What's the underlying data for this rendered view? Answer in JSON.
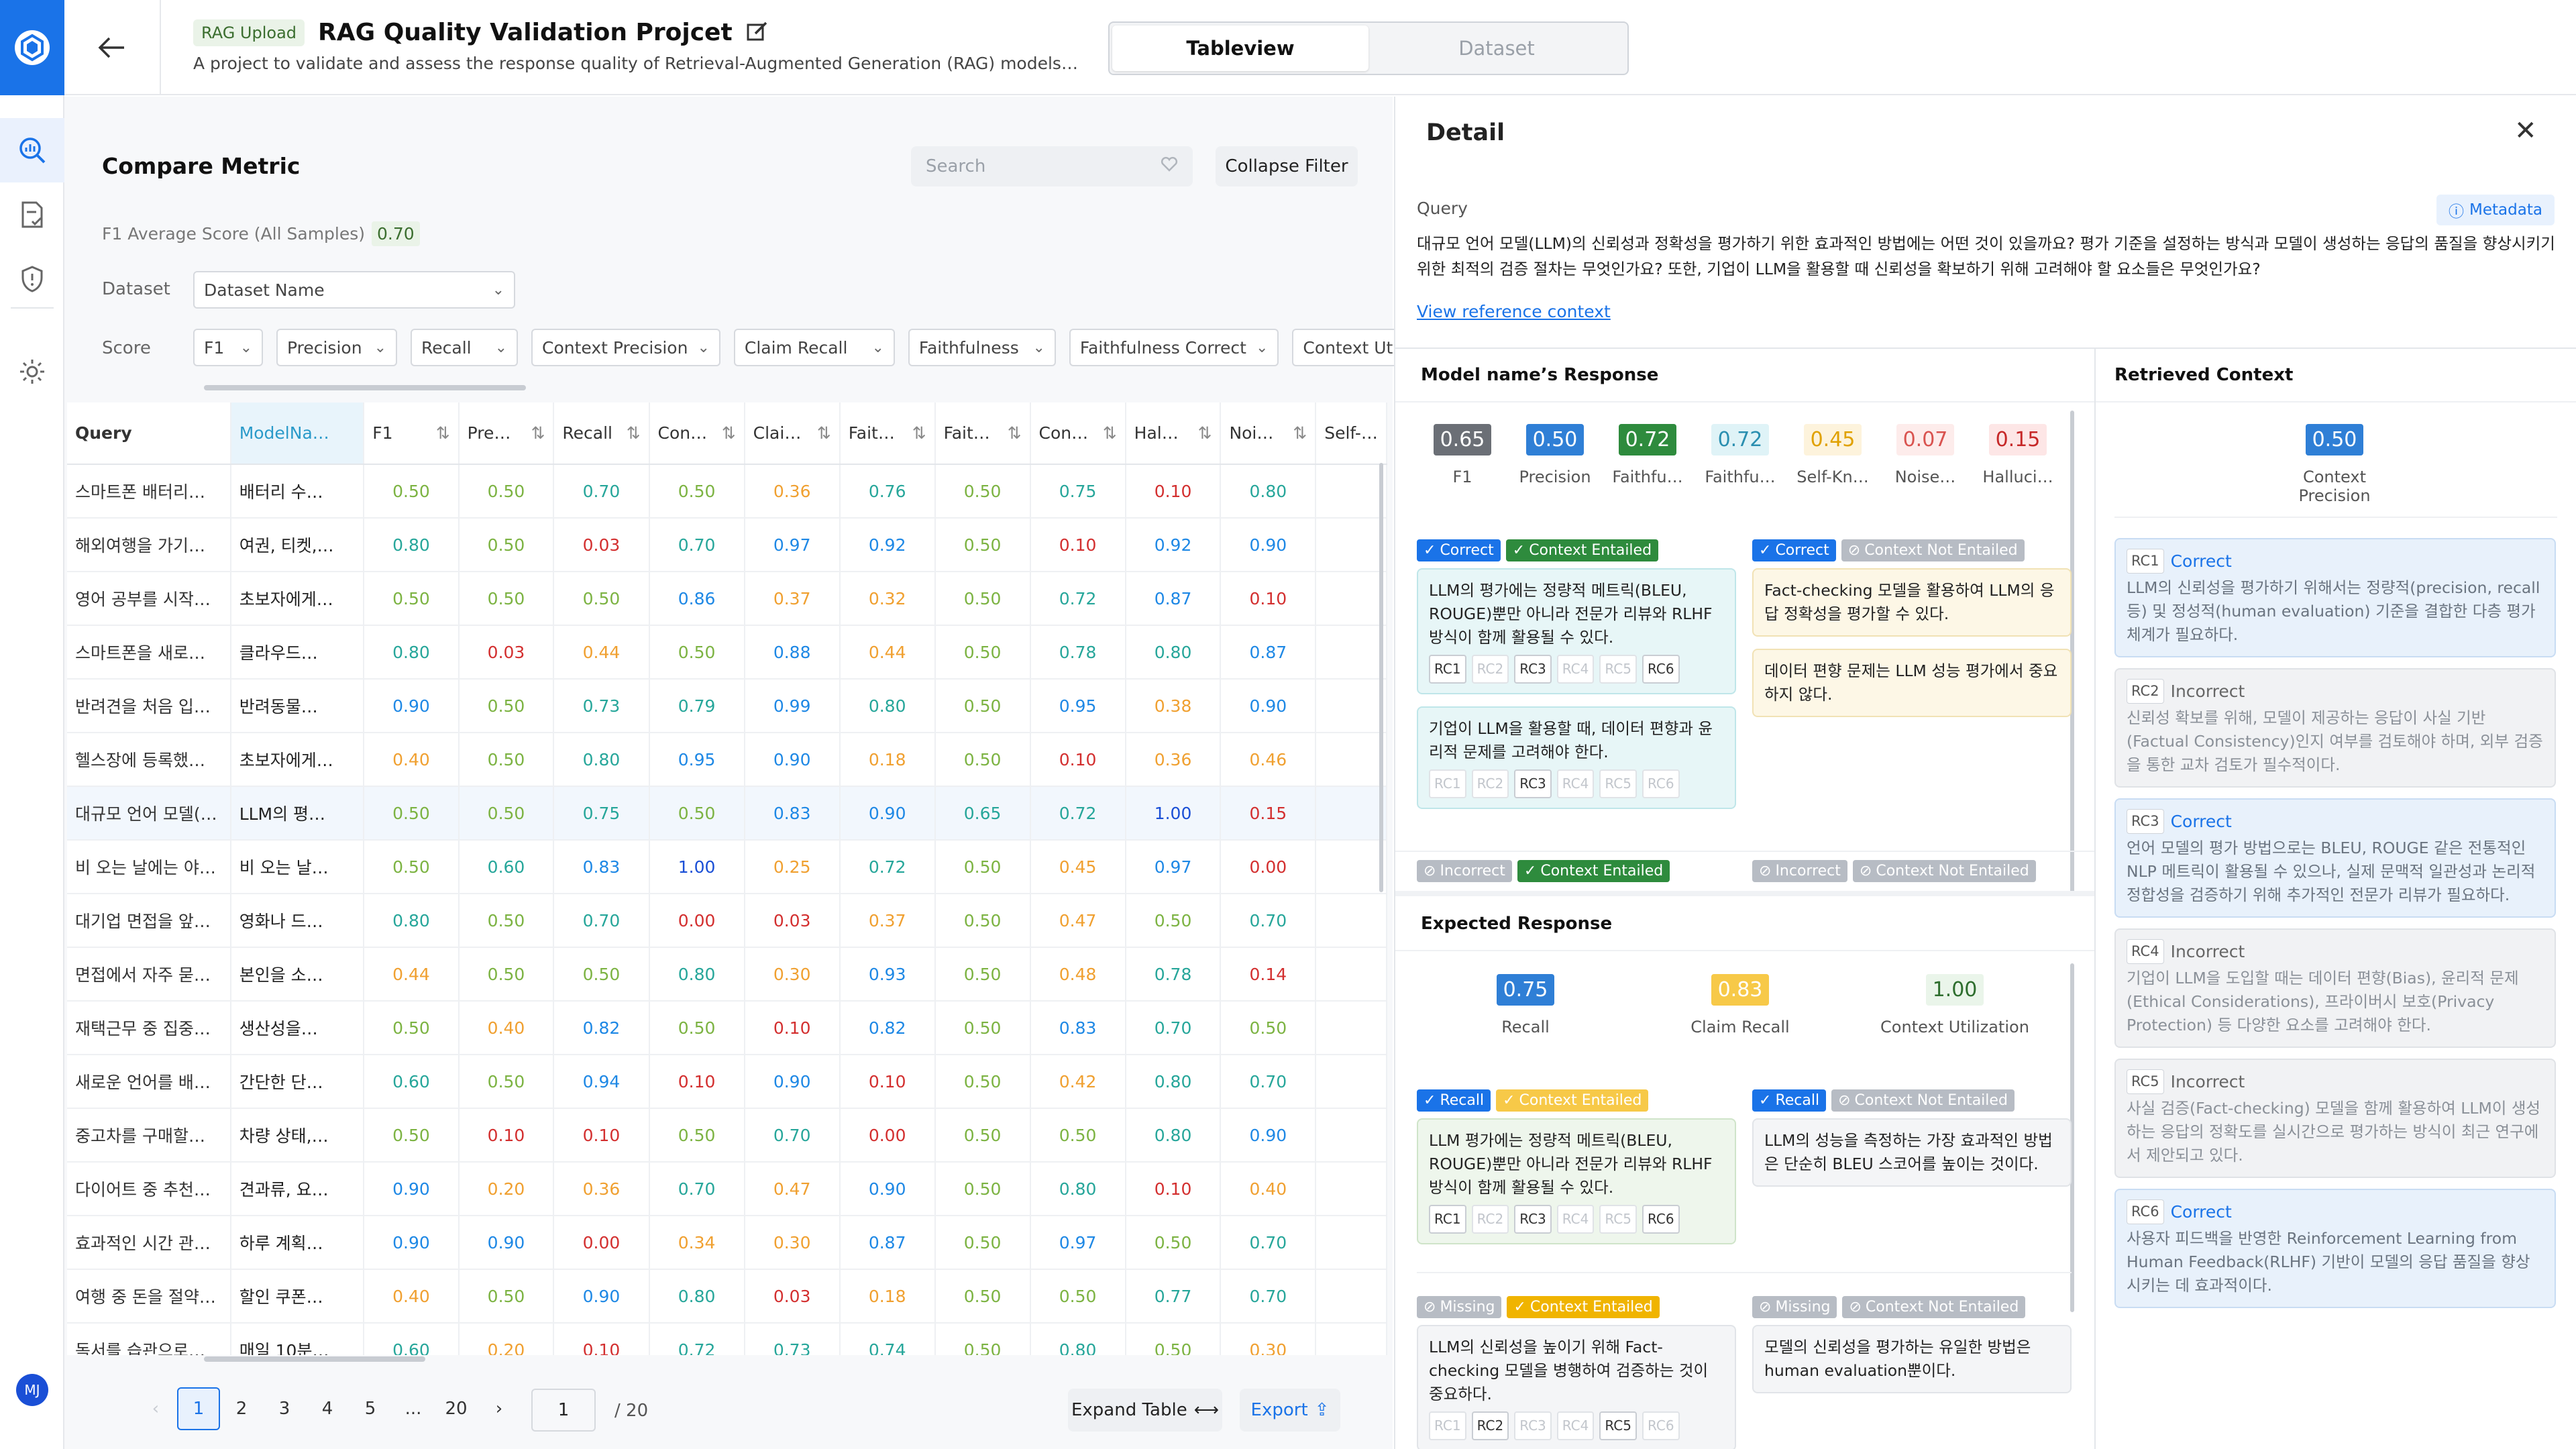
{
  "header": {
    "badge": "RAG Upload",
    "title": "RAG Quality Validation Projcet",
    "subtitle": "A project to validate and assess the response quality of Retrieval-Augmented Generation (RAG) models using curated…",
    "views": [
      "Tableview",
      "Dataset"
    ],
    "active_view": "Tableview"
  },
  "rail": {
    "user_initials": "MJ",
    "icons": [
      "logo-icon",
      "analytics-icon",
      "document-check-icon",
      "shield-icon",
      "settings-gear-icon"
    ]
  },
  "compare": {
    "title": "Compare Metric",
    "search_placeholder": "Search",
    "collapse_label": "Collapse Filter",
    "f1_label": "F1 Average Score (All Samples)",
    "f1_value": "0.70",
    "dataset_label": "Dataset",
    "dataset_value": "Dataset Name",
    "score_label": "Score",
    "score_filters": [
      "F1",
      "Precision",
      "Recall",
      "Context Precision",
      "Claim Recall",
      "Faithfulness",
      "Faithfulness Correct",
      "Context Utilizati…"
    ]
  },
  "table": {
    "columns": [
      "Query",
      "ModelNa…",
      "F1",
      "Pre…",
      "Recall",
      "Con…",
      "Clai…",
      "Fait…",
      "Fait…",
      "Con…",
      "Hal…",
      "Noi…",
      "Self-…"
    ],
    "rows": [
      {
        "q": "스마트폰 배터리…",
        "m": "배터리 수…",
        "v": [
          "0.50",
          "0.50",
          "0.70",
          "0.50",
          "0.36",
          "0.76",
          "0.50",
          "0.75",
          "0.10",
          "0.80"
        ]
      },
      {
        "q": "해외여행을 가기…",
        "m": "여권, 티켓,…",
        "v": [
          "0.80",
          "0.50",
          "0.03",
          "0.70",
          "0.97",
          "0.92",
          "0.50",
          "0.10",
          "0.92",
          "0.90"
        ]
      },
      {
        "q": "영어 공부를 시작…",
        "m": "초보자에게…",
        "v": [
          "0.50",
          "0.50",
          "0.50",
          "0.86",
          "0.37",
          "0.32",
          "0.50",
          "0.72",
          "0.87",
          "0.10"
        ]
      },
      {
        "q": "스마트폰을 새로…",
        "m": "클라우드…",
        "v": [
          "0.80",
          "0.03",
          "0.44",
          "0.50",
          "0.88",
          "0.44",
          "0.50",
          "0.78",
          "0.80",
          "0.87"
        ]
      },
      {
        "q": "반려견을 처음 입…",
        "m": "반려동물…",
        "v": [
          "0.90",
          "0.50",
          "0.73",
          "0.79",
          "0.99",
          "0.80",
          "0.50",
          "0.95",
          "0.38",
          "0.90"
        ]
      },
      {
        "q": "헬스장에 등록했…",
        "m": "초보자에게…",
        "v": [
          "0.40",
          "0.50",
          "0.80",
          "0.95",
          "0.90",
          "0.18",
          "0.50",
          "0.10",
          "0.36",
          "0.46"
        ]
      },
      {
        "q": "대규모 언어 모델(…",
        "m": "LLM의 평…",
        "v": [
          "0.50",
          "0.50",
          "0.75",
          "0.50",
          "0.83",
          "0.90",
          "0.65",
          "0.72",
          "1.00",
          "0.15"
        ],
        "sel": true
      },
      {
        "q": "비 오는 날에는 야…",
        "m": "비 오는 날…",
        "v": [
          "0.50",
          "0.60",
          "0.83",
          "1.00",
          "0.25",
          "0.72",
          "0.50",
          "0.45",
          "0.97",
          "0.00"
        ]
      },
      {
        "q": "대기업 면접을 앞…",
        "m": "영화나 드…",
        "v": [
          "0.80",
          "0.50",
          "0.70",
          "0.00",
          "0.03",
          "0.37",
          "0.50",
          "0.47",
          "0.50",
          "0.70"
        ]
      },
      {
        "q": "면접에서 자주 묻…",
        "m": "본인을 소…",
        "v": [
          "0.44",
          "0.50",
          "0.50",
          "0.80",
          "0.30",
          "0.93",
          "0.50",
          "0.48",
          "0.78",
          "0.14"
        ]
      },
      {
        "q": "재택근무 중 집중…",
        "m": "생산성을…",
        "v": [
          "0.50",
          "0.40",
          "0.82",
          "0.50",
          "0.10",
          "0.82",
          "0.50",
          "0.83",
          "0.70",
          "0.50"
        ]
      },
      {
        "q": "새로운 언어를 배…",
        "m": "간단한 단…",
        "v": [
          "0.60",
          "0.50",
          "0.94",
          "0.10",
          "0.90",
          "0.10",
          "0.50",
          "0.42",
          "0.80",
          "0.70"
        ]
      },
      {
        "q": "중고차를 구매할…",
        "m": "차량 상태,…",
        "v": [
          "0.50",
          "0.10",
          "0.10",
          "0.50",
          "0.70",
          "0.00",
          "0.50",
          "0.50",
          "0.80",
          "0.90"
        ]
      },
      {
        "q": "다이어트 중 추천…",
        "m": "견과류, 요…",
        "v": [
          "0.90",
          "0.20",
          "0.36",
          "0.70",
          "0.47",
          "0.90",
          "0.50",
          "0.80",
          "0.10",
          "0.40"
        ]
      },
      {
        "q": "효과적인 시간 관…",
        "m": "하루 계획…",
        "v": [
          "0.90",
          "0.90",
          "0.00",
          "0.34",
          "0.30",
          "0.87",
          "0.50",
          "0.97",
          "0.50",
          "0.70"
        ]
      },
      {
        "q": "여행 중 돈을 절약…",
        "m": "할인 쿠폰…",
        "v": [
          "0.40",
          "0.50",
          "0.90",
          "0.80",
          "0.03",
          "0.18",
          "0.50",
          "0.50",
          "0.77",
          "0.70"
        ]
      },
      {
        "q": "독서를 습관으로…",
        "m": "매일 10분…",
        "v": [
          "0.60",
          "0.20",
          "0.10",
          "0.72",
          "0.73",
          "0.74",
          "0.50",
          "0.80",
          "0.50",
          "0.30"
        ]
      }
    ]
  },
  "pagination": {
    "pages": [
      "1",
      "2",
      "3",
      "4",
      "5",
      "...",
      "20"
    ],
    "current": "1",
    "input_value": "1",
    "total": "/ 20",
    "expand_label": "Expand Table",
    "export_label": "Export"
  },
  "detail": {
    "title": "Detail",
    "query_label": "Query",
    "metadata_label": "Metadata",
    "query_text": "대규모 언어 모델(LLM)의 신뢰성과 정확성을 평가하기 위한 효과적인 방법에는 어떤 것이 있을까요? 평가 기준을 설정하는 방식과 모델이 생성하는 응답의 품질을 향상시키기 위한 최적의 검증 절차는 무엇인가요? 또한, 기업이 LLM을 활용할 때 신뢰성을 확보하기 위해 고려해야 할 요소들은 무엇인가요?",
    "ref_link": "View reference context",
    "model_response_title": "Model name’s Response",
    "model_metrics": [
      {
        "v": "0.65",
        "l": "F1",
        "bg": "#6b6f76",
        "fg": "#ffffff"
      },
      {
        "v": "0.50",
        "l": "Precision",
        "bg": "#2f7fd6",
        "fg": "#ffffff"
      },
      {
        "v": "0.72",
        "l": "Faithfu…",
        "bg": "#2e8b3d",
        "fg": "#ffffff"
      },
      {
        "v": "0.72",
        "l": "Faithfu…",
        "bg": "#dff3f7",
        "fg": "#2a8fb0"
      },
      {
        "v": "0.45",
        "l": "Self-Kn…",
        "bg": "#fdf3dc",
        "fg": "#e0a100"
      },
      {
        "v": "0.07",
        "l": "Noise…",
        "bg": "#fdeceb",
        "fg": "#d9534f"
      },
      {
        "v": "0.15",
        "l": "Halluci…",
        "bg": "#fde6e6",
        "fg": "#c62828"
      }
    ],
    "claim_tags": {
      "correct": "Correct",
      "incorrect": "Incorrect",
      "ctx_ent": "Context Entailed",
      "ctx_not": "Context Not Entailed",
      "recall": "Recall",
      "missing": "Missing"
    },
    "rc_labels": [
      "RC1",
      "RC2",
      "RC3",
      "RC4",
      "RC5",
      "RC6"
    ],
    "model_claims": {
      "left": [
        {
          "text": "LLM의 평가에는 정량적 메트릭(BLEU, ROUGE)뿐만 아니라 전문가 리뷰와 RLHF 방식이 함께 활용될 수 있다."
        },
        {
          "text": "기업이 LLM을 활용할 때, 데이터 편향과 윤리적 문제를 고려해야 한다."
        }
      ],
      "right": [
        {
          "text": "Fact-checking 모델을 활용하여 LLM의 응답 정확성을 평가할 수 있다."
        },
        {
          "text": "데이터 편향 문제는 LLM 성능 평가에서 중요하지 않다."
        }
      ]
    },
    "expected_title": "Expected Response",
    "expected_metrics": [
      {
        "v": "0.75",
        "l": "Recall",
        "bg": "#2f7fd6",
        "fg": "#ffffff"
      },
      {
        "v": "0.83",
        "l": "Claim Recall",
        "bg": "#f7c948",
        "fg": "#ffffff"
      },
      {
        "v": "1.00",
        "l": "Context Utilization",
        "bg": "#eaf5ea",
        "fg": "#2e6e2e"
      }
    ],
    "expected_claims": {
      "recall_left": "LLM 평가에는 정량적 메트릭(BLEU, ROUGE)뿐만 아니라 전문가 리뷰와 RLHF 방식이 함께 활용될 수 있다.",
      "recall_right": "LLM의 성능을 측정하는 가장 효과적인 방법은 단순히 BLEU 스코어를 높이는 것이다.",
      "missing_left": "LLM의 신뢰성을 높이기 위해 Fact-checking 모델을 병행하여 검증하는 것이 중요하다.",
      "missing_right": "모델의 신뢰성을 평가하는 유일한 방법은 human evaluation뿐이다."
    },
    "retrieved_title": "Retrieved Context",
    "context_precision_value": "0.50",
    "context_precision_label": "Context Precision",
    "contexts": [
      {
        "id": "RC1",
        "status": "Correct",
        "text": "LLM의 신뢰성을 평가하기 위해서는 정량적(precision, recall 등) 및 정성적(human evaluation) 기준을 결합한 다층 평가 체계가 필요하다."
      },
      {
        "id": "RC2",
        "status": "Incorrect",
        "text": "신뢰성 확보를 위해, 모델이 제공하는 응답이 사실 기반(Factual Consistency)인지 여부를 검토해야 하며, 외부 검증을 통한 교차 검토가 필수적이다."
      },
      {
        "id": "RC3",
        "status": "Correct",
        "text": "언어 모델의 평가 방법으로는 BLEU, ROUGE 같은 전통적인 NLP 메트릭이 활용될 수 있으나, 실제 문맥적 일관성과 논리적 정합성을 검증하기 위해 추가적인 전문가 리뷰가 필요하다."
      },
      {
        "id": "RC4",
        "status": "Incorrect",
        "text": "기업이 LLM을 도입할 때는 데이터 편향(Bias), 윤리적 문제(Ethical Considerations), 프라이버시 보호(Privacy Protection) 등 다양한 요소를 고려해야 한다."
      },
      {
        "id": "RC5",
        "status": "Incorrect",
        "text": "사실 검증(Fact-checking) 모델을 함께 활용하여 LLM이 생성하는 응답의 정확도를 실시간으로 평가하는 방식이 최근 연구에서 제안되고 있다."
      },
      {
        "id": "RC6",
        "status": "Correct",
        "text": "사용자 피드백을 반영한 Reinforcement Learning from Human Feedback(RLHF) 기반이 모델의 응답 품질을 향상시키는 데 효과적이다."
      }
    ]
  },
  "colors": {
    "accent": "#1a73e8",
    "score_red": "#d32f2f",
    "score_orange": "#f0a030",
    "score_green": "#7cb342",
    "score_teal": "#26a69a",
    "score_blue": "#1e88e5",
    "score_darkblue": "#1a4fd6"
  }
}
